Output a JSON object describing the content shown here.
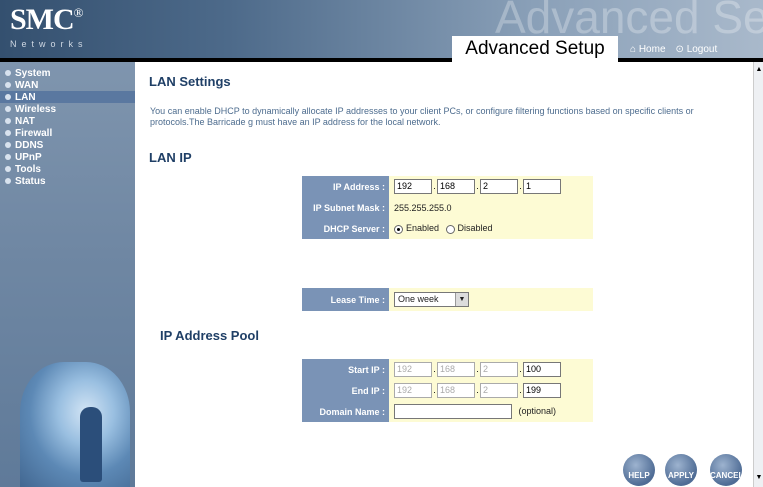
{
  "header": {
    "logo": "SMC",
    "logo_reg": "®",
    "logo_sub": "Networks",
    "watermark": "Advanced Setup",
    "title": "Advanced Setup",
    "home_label": "Home",
    "logout_label": "Logout"
  },
  "sidebar": {
    "items": [
      {
        "label": "System"
      },
      {
        "label": "WAN"
      },
      {
        "label": "LAN"
      },
      {
        "label": "Wireless"
      },
      {
        "label": "NAT"
      },
      {
        "label": "Firewall"
      },
      {
        "label": "DDNS"
      },
      {
        "label": "UPnP"
      },
      {
        "label": "Tools"
      },
      {
        "label": "Status"
      }
    ],
    "active": "LAN"
  },
  "main": {
    "heading": "LAN Settings",
    "description": "You can enable DHCP to dynamically allocate IP addresses to your client PCs, or configure filtering functions based on specific clients or protocols.The Barricade g must have an IP address for the local network.",
    "lan_ip_heading": "LAN IP",
    "ip_address_label": "IP Address :",
    "ip_address": [
      "192",
      "168",
      "2",
      "1"
    ],
    "subnet_label": "IP Subnet Mask :",
    "subnet_value": "255.255.255.0",
    "dhcp_label": "DHCP Server :",
    "dhcp_enabled_label": "Enabled",
    "dhcp_disabled_label": "Disabled",
    "dhcp_selected": "Enabled",
    "lease_label": "Lease Time :",
    "lease_value": "One week",
    "pool_heading": "IP Address Pool",
    "start_label": "Start IP :",
    "start_ip": [
      "192",
      "168",
      "2",
      "100"
    ],
    "end_label": "End IP :",
    "end_ip": [
      "192",
      "168",
      "2",
      "199"
    ],
    "domain_label": "Domain Name :",
    "domain_value": "",
    "domain_optional": "(optional)"
  },
  "buttons": {
    "help": "HELP",
    "apply": "APPLY",
    "cancel": "CANCEL"
  },
  "colors": {
    "label_bg": "#7a93b6",
    "value_bg": "#fdfbd4",
    "heading": "#1f3f66",
    "sidebar": "#7288a4"
  }
}
